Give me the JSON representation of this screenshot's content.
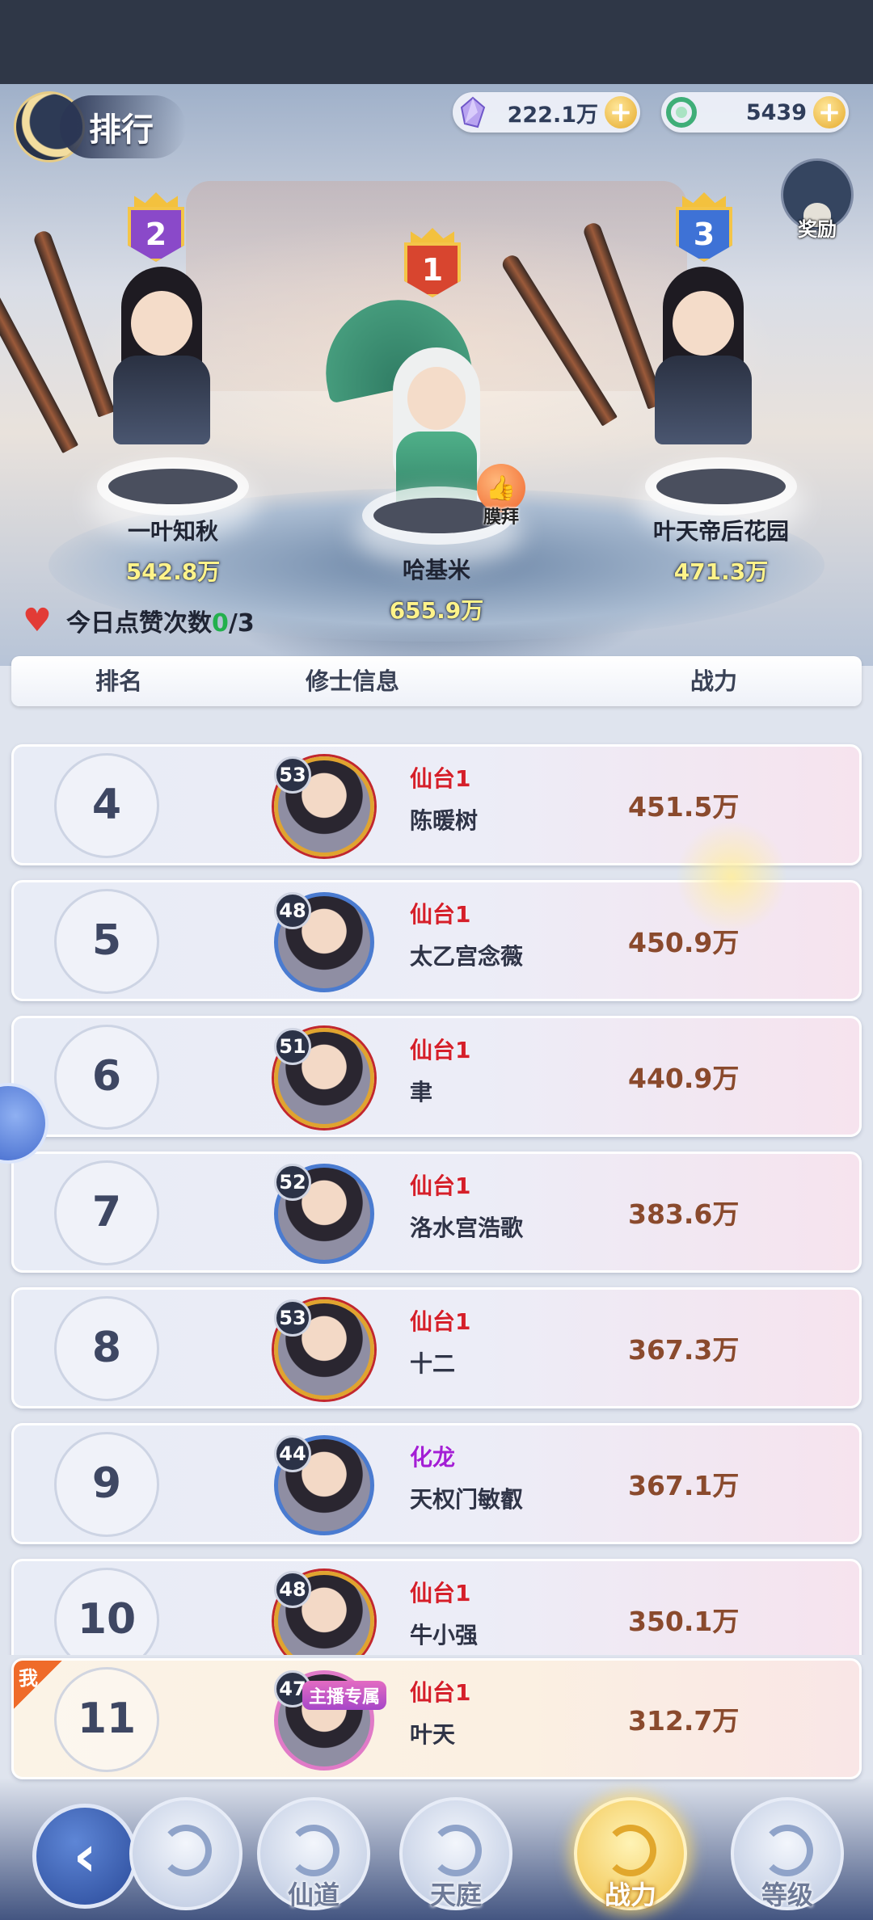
{
  "header": {
    "title": "排行"
  },
  "currencies": [
    {
      "icon": "crystal-icon",
      "value": "222.1万"
    },
    {
      "icon": "jade-dragon-icon",
      "value": "5439"
    }
  ],
  "reward": {
    "label": "奖励"
  },
  "podium": [
    {
      "rank": "1",
      "name": "哈基米",
      "power": "655.9万",
      "badge_color": "#d8452f"
    },
    {
      "rank": "2",
      "name": "一叶知秋",
      "power": "542.8万",
      "badge_color": "#8a49c9"
    },
    {
      "rank": "3",
      "name": "叶天帝后花园",
      "power": "471.3万",
      "badge_color": "#3e72d6"
    }
  ],
  "worship_label": "膜拜",
  "likes": {
    "label": "今日点赞次数",
    "current": "0",
    "total": "/3"
  },
  "table_header": {
    "rank": "排名",
    "info": "修士信息",
    "power": "战力"
  },
  "rows": [
    {
      "rank": "4",
      "level": "53",
      "realm": "仙台1",
      "name": "陈暖树",
      "power": "451.5万"
    },
    {
      "rank": "5",
      "level": "48",
      "realm": "仙台1",
      "name": "太乙宫念薇",
      "power": "450.9万"
    },
    {
      "rank": "6",
      "level": "51",
      "realm": "仙台1",
      "name": "聿",
      "power": "440.9万"
    },
    {
      "rank": "7",
      "level": "52",
      "realm": "仙台1",
      "name": "洛水宫浩歌",
      "power": "383.6万"
    },
    {
      "rank": "8",
      "level": "53",
      "realm": "仙台1",
      "name": "十二",
      "power": "367.3万"
    },
    {
      "rank": "9",
      "level": "44",
      "realm": "化龙",
      "name": "天权门敏叡",
      "power": "367.1万"
    },
    {
      "rank": "10",
      "level": "48",
      "realm": "仙台1",
      "name": "牛小强",
      "power": "350.1万"
    }
  ],
  "self_row": {
    "tag": "我",
    "rank": "11",
    "level": "47",
    "realm": "仙台1",
    "name": "叶天",
    "power": "312.7万",
    "anchor_tag": "主播专属"
  },
  "nav": {
    "items": [
      {
        "label": ""
      },
      {
        "label": "仙道"
      },
      {
        "label": "天庭"
      },
      {
        "label": "战力"
      },
      {
        "label": "等级"
      }
    ],
    "active": "战力"
  }
}
